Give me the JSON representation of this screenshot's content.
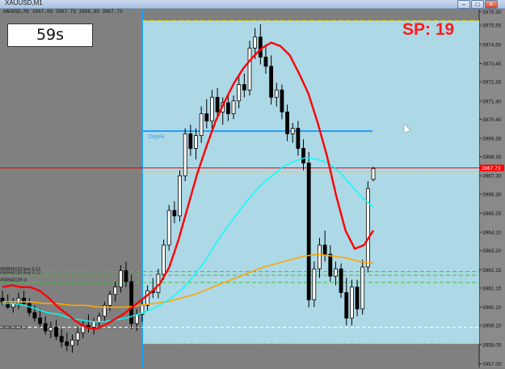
{
  "window": {
    "title": "XAUUSD,M1",
    "buttons": {
      "minimize": "–",
      "maximize": "□",
      "close": "×"
    }
  },
  "ohlc_readout": "XAUUSD,M1  3967.09 3967.73 3966.99 3967.73",
  "timer_text": "59s",
  "spread_text": "SP: 19",
  "box_label": "Day/H",
  "order_lines": [
    {
      "label": "#50843133 buy 0.12"
    },
    {
      "label": "#50843130 Buy 0.12"
    },
    {
      "label": "#50843128 sl"
    }
  ],
  "price_tag": "3967.73",
  "colors": {
    "chart_bg": "#808080",
    "box_fill": "#add8e6",
    "candle": "#000000",
    "ma_red": "#ff0000",
    "ma_cyan": "#00ffff",
    "ma_orange": "#ffa500",
    "price_line": "#ff0000",
    "spread_text": "#ff1a1a"
  },
  "chart_data": {
    "type": "line",
    "symbol": "XAUUSD",
    "timeframe": "M1",
    "ylim": [
      3956.8,
      3976.4
    ],
    "y_ticks": [
      "3976.30",
      "3975.55",
      "3974.50",
      "3973.45",
      "3972.45",
      "3971.40",
      "3970.40",
      "3969.35",
      "3968.35",
      "3967.30",
      "3966.30",
      "3965.25",
      "3964.20",
      "3963.20",
      "3962.15",
      "3961.15",
      "3960.10",
      "3959.10",
      "3958.05",
      "3957.00"
    ],
    "last_price": 3967.73,
    "ohlc": {
      "open": 3967.09,
      "high": 3967.73,
      "low": 3966.99,
      "close": 3967.73
    },
    "candles": [
      [
        3960.6,
        3961.0,
        3960.2,
        3960.4
      ],
      [
        3960.4,
        3960.8,
        3960.0,
        3960.1
      ],
      [
        3960.1,
        3960.6,
        3959.8,
        3960.3
      ],
      [
        3960.3,
        3960.9,
        3960.0,
        3960.6
      ],
      [
        3960.6,
        3961.0,
        3960.2,
        3960.3
      ],
      [
        3960.3,
        3960.6,
        3959.6,
        3959.8
      ],
      [
        3959.8,
        3960.2,
        3959.3,
        3959.5
      ],
      [
        3959.5,
        3960.0,
        3959.0,
        3959.2
      ],
      [
        3959.2,
        3959.6,
        3958.6,
        3958.8
      ],
      [
        3958.8,
        3959.3,
        3958.4,
        3959.0
      ],
      [
        3959.0,
        3959.4,
        3958.3,
        3958.5
      ],
      [
        3958.5,
        3958.9,
        3957.9,
        3958.2
      ],
      [
        3958.2,
        3958.7,
        3957.7,
        3958.0
      ],
      [
        3958.0,
        3958.6,
        3957.6,
        3958.3
      ],
      [
        3958.3,
        3959.0,
        3958.0,
        3958.7
      ],
      [
        3958.7,
        3959.4,
        3958.4,
        3959.1
      ],
      [
        3959.1,
        3959.7,
        3958.7,
        3959.0
      ],
      [
        3959.0,
        3959.5,
        3958.6,
        3959.3
      ],
      [
        3959.3,
        3959.8,
        3958.9,
        3959.6
      ],
      [
        3959.6,
        3960.4,
        3959.3,
        3960.2
      ],
      [
        3960.2,
        3961.0,
        3959.9,
        3960.8
      ],
      [
        3960.8,
        3961.5,
        3960.4,
        3961.2
      ],
      [
        3961.2,
        3962.4,
        3960.9,
        3962.1
      ],
      [
        3962.1,
        3962.6,
        3961.2,
        3961.5
      ],
      [
        3961.5,
        3961.9,
        3958.9,
        3959.2
      ],
      [
        3959.2,
        3960.0,
        3958.8,
        3959.7
      ],
      [
        3959.7,
        3960.5,
        3959.3,
        3960.2
      ],
      [
        3960.2,
        3961.3,
        3959.9,
        3961.0
      ],
      [
        3961.0,
        3961.7,
        3960.6,
        3960.9
      ],
      [
        3960.9,
        3962.2,
        3960.6,
        3961.9
      ],
      [
        3961.9,
        3963.8,
        3961.6,
        3963.5
      ],
      [
        3963.5,
        3965.7,
        3963.2,
        3965.4
      ],
      [
        3965.4,
        3965.9,
        3964.7,
        3965.1
      ],
      [
        3965.1,
        3967.6,
        3964.8,
        3967.3
      ],
      [
        3967.3,
        3969.9,
        3967.0,
        3969.6
      ],
      [
        3969.6,
        3970.1,
        3968.4,
        3968.8
      ],
      [
        3968.8,
        3969.9,
        3968.2,
        3969.5
      ],
      [
        3969.5,
        3971.1,
        3969.1,
        3970.7
      ],
      [
        3970.7,
        3971.5,
        3969.9,
        3970.3
      ],
      [
        3970.3,
        3972.0,
        3969.8,
        3971.6
      ],
      [
        3971.6,
        3972.1,
        3970.4,
        3970.8
      ],
      [
        3970.8,
        3971.6,
        3970.1,
        3971.3
      ],
      [
        3971.3,
        3971.8,
        3970.3,
        3970.7
      ],
      [
        3970.7,
        3971.7,
        3970.4,
        3971.4
      ],
      [
        3971.4,
        3972.7,
        3971.0,
        3972.3
      ],
      [
        3972.3,
        3972.9,
        3971.6,
        3972.0
      ],
      [
        3972.0,
        3974.7,
        3971.7,
        3974.3
      ],
      [
        3974.3,
        3975.4,
        3973.7,
        3974.9
      ],
      [
        3974.9,
        3975.6,
        3973.4,
        3973.8
      ],
      [
        3973.8,
        3974.5,
        3972.9,
        3973.3
      ],
      [
        3973.3,
        3973.9,
        3971.2,
        3971.6
      ],
      [
        3971.6,
        3972.4,
        3971.1,
        3972.0
      ],
      [
        3972.0,
        3972.3,
        3970.4,
        3970.8
      ],
      [
        3970.8,
        3971.2,
        3969.2,
        3969.6
      ],
      [
        3969.6,
        3970.2,
        3969.1,
        3969.9
      ],
      [
        3969.9,
        3970.3,
        3968.4,
        3968.8
      ],
      [
        3968.8,
        3969.3,
        3967.6,
        3968.0
      ],
      [
        3968.0,
        3968.6,
        3960.1,
        3960.5
      ],
      [
        3960.5,
        3962.6,
        3960.1,
        3962.2
      ],
      [
        3962.2,
        3963.9,
        3961.7,
        3963.5
      ],
      [
        3963.5,
        3964.3,
        3962.6,
        3963.0
      ],
      [
        3963.0,
        3963.5,
        3961.5,
        3961.8
      ],
      [
        3961.8,
        3962.6,
        3961.3,
        3962.2
      ],
      [
        3962.2,
        3962.5,
        3960.6,
        3960.9
      ],
      [
        3960.9,
        3961.7,
        3959.1,
        3959.5
      ],
      [
        3959.5,
        3961.6,
        3959.1,
        3961.2
      ],
      [
        3961.2,
        3961.6,
        3959.6,
        3960.0
      ],
      [
        3960.0,
        3962.7,
        3959.7,
        3962.3
      ],
      [
        3962.3,
        3967.0,
        3962.0,
        3966.6
      ],
      [
        3967.1,
        3967.8,
        3967.0,
        3967.7
      ]
    ],
    "series": [
      {
        "values": [
          3961.2,
          3961.3,
          3961.2,
          3961.2,
          3961.0,
          3960.6,
          3960.1,
          3959.7,
          3959.3,
          3959.0,
          3958.9,
          3959.1,
          3959.4,
          3959.7,
          3960.1,
          3960.5,
          3960.9,
          3961.4,
          3962.3,
          3963.8,
          3965.6,
          3967.4,
          3968.9,
          3970.3,
          3971.4,
          3972.4,
          3973.2,
          3973.8,
          3974.3,
          3974.6,
          3974.4,
          3973.9,
          3972.9,
          3971.8,
          3970.2,
          3968.4,
          3966.2,
          3964.3,
          3963.3,
          3963.5,
          3964.3
        ]
      },
      {
        "values": [
          3960.3,
          3960.3,
          3960.2,
          3960.0,
          3959.8,
          3959.7,
          3959.5,
          3959.4,
          3959.3,
          3959.3,
          3959.4,
          3959.5,
          3959.7,
          3959.9,
          3960.2,
          3960.6,
          3961.1,
          3961.8,
          3962.6,
          3963.6,
          3964.5,
          3965.3,
          3966.1,
          3966.8,
          3967.3,
          3967.8,
          3968.1,
          3968.3,
          3968.2,
          3968.0,
          3967.5,
          3966.8,
          3966.1,
          3965.6
        ]
      },
      {
        "values": [
          3960.4,
          3960.4,
          3960.4,
          3960.3,
          3960.3,
          3960.2,
          3960.2,
          3960.1,
          3960.1,
          3960.1,
          3960.2,
          3960.3,
          3960.4,
          3960.6,
          3960.8,
          3961.1,
          3961.4,
          3961.7,
          3962.0,
          3962.3,
          3962.5,
          3962.7,
          3962.9,
          3963.0,
          3962.9,
          3962.8,
          3962.6,
          3962.5
        ]
      }
    ]
  }
}
